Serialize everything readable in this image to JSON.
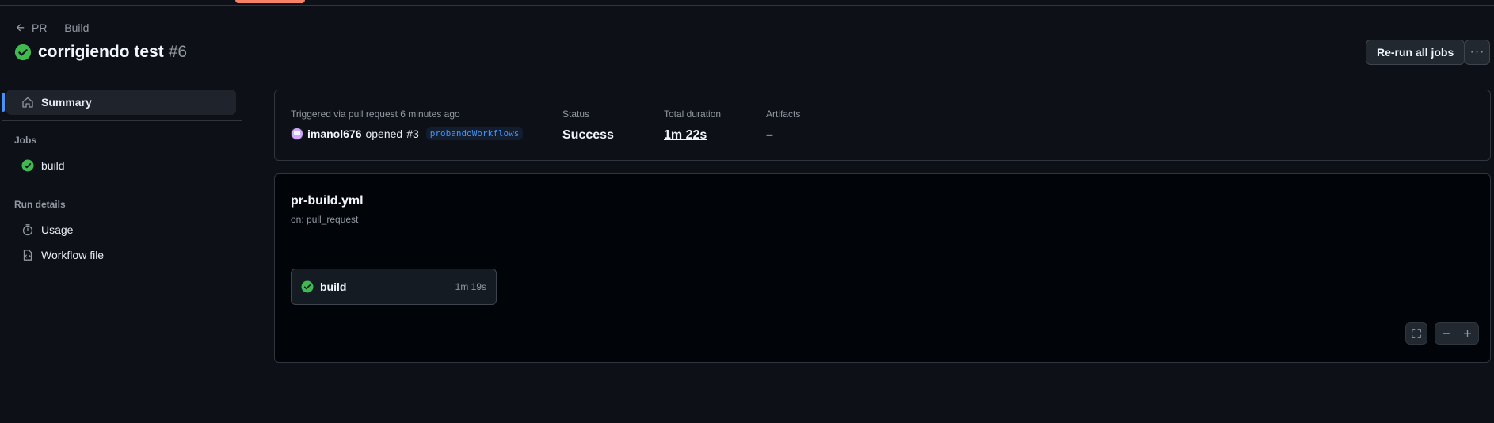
{
  "header": {
    "back_label": "PR — Build",
    "run_title": "corrigiendo test",
    "run_number": "#6",
    "rerun_label": "Re-run all jobs",
    "more_label": "···"
  },
  "sidebar": {
    "summary_label": "Summary",
    "jobs_section": "Jobs",
    "jobs": [
      {
        "label": "build",
        "status": "success"
      }
    ],
    "run_details_section": "Run details",
    "usage_label": "Usage",
    "workflow_file_label": "Workflow file"
  },
  "summary": {
    "trigger_label": "Triggered via pull request 6 minutes ago",
    "user": "imanol676",
    "opened_text": "opened",
    "pr_number": "#3",
    "branch": "probandoWorkflows",
    "status_label": "Status",
    "status_value": "Success",
    "duration_label": "Total duration",
    "duration_value": "1m 22s",
    "artifacts_label": "Artifacts",
    "artifacts_value": "–"
  },
  "workflow": {
    "file": "pr-build.yml",
    "trigger": "on: pull_request",
    "job_name": "build",
    "job_duration": "1m 19s",
    "zoom_out": "−",
    "zoom_in": "+"
  },
  "colors": {
    "success": "#3fb950",
    "accent": "#4493f8",
    "tab_indicator": "#f78166"
  }
}
